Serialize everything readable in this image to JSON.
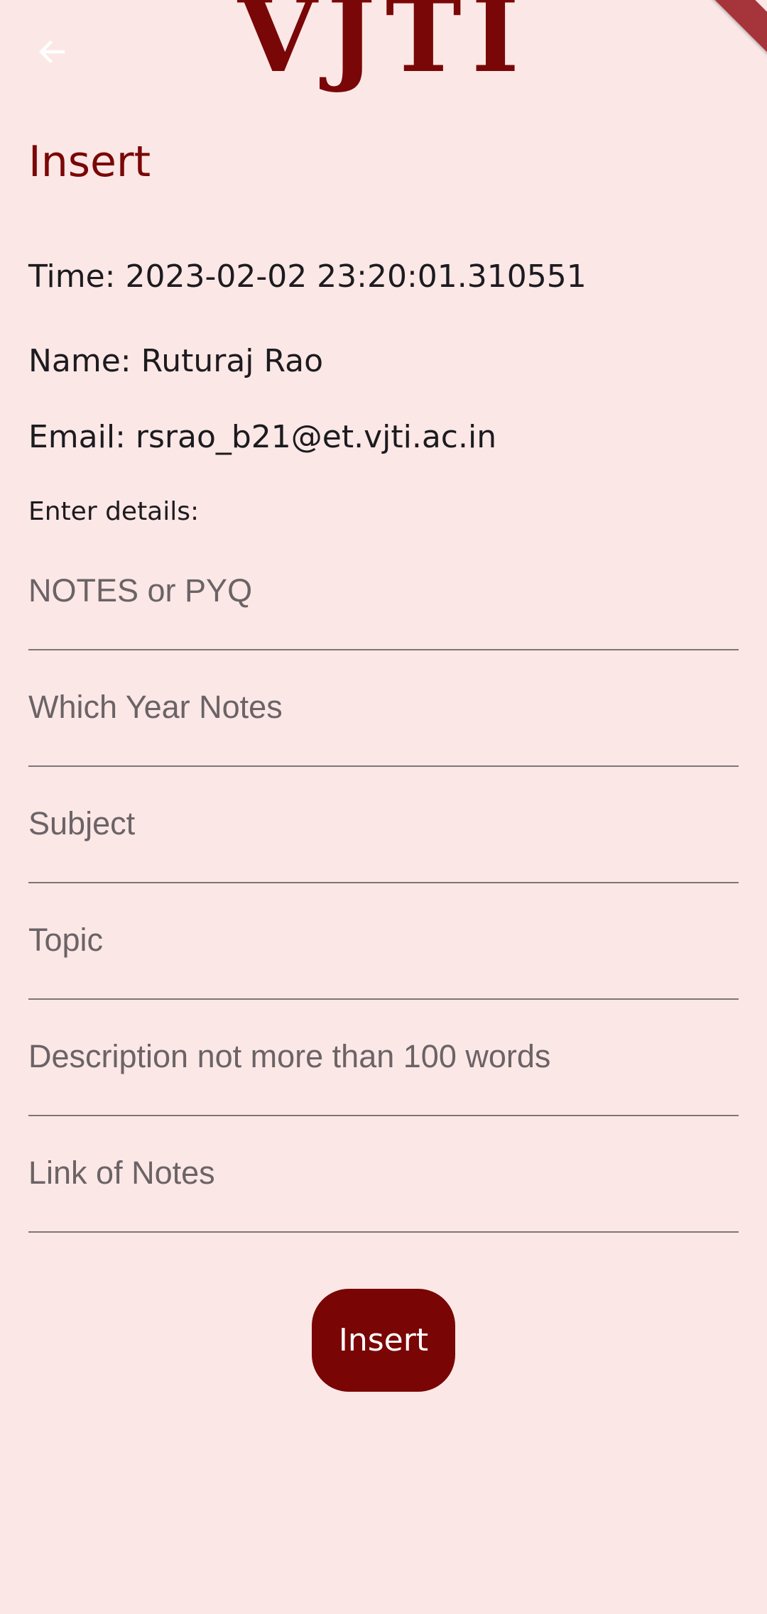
{
  "app_bar": {
    "logo_text": "VJTI",
    "back_icon": "arrow-left-icon"
  },
  "page": {
    "title": "Insert"
  },
  "info": {
    "time": "Time: 2023-02-02 23:20:01.310551",
    "name": "Name: Ruturaj Rao",
    "email": "Email: rsrao_b21@et.vjti.ac.in"
  },
  "form": {
    "label": "Enter details:",
    "fields": [
      {
        "placeholder": "NOTES or PYQ",
        "value": ""
      },
      {
        "placeholder": "Which Year Notes",
        "value": ""
      },
      {
        "placeholder": "Subject",
        "value": ""
      },
      {
        "placeholder": "Topic",
        "value": ""
      },
      {
        "placeholder": "Description not more than 100 words",
        "value": ""
      },
      {
        "placeholder": "Link of Notes",
        "value": ""
      }
    ],
    "submit_label": "Insert"
  },
  "colors": {
    "accent": "#7a0707",
    "background": "#fbe7e6",
    "button": "#7a0505",
    "underline": "#7d7677"
  }
}
